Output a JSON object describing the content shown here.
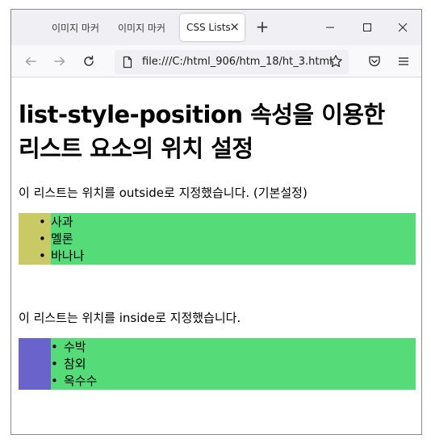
{
  "browser": {
    "tabs": [
      {
        "label": "이미지 마커",
        "active": false
      },
      {
        "label": "이미지 마커",
        "active": false
      },
      {
        "label": "CSS Lists",
        "active": true
      }
    ],
    "url": "file:///C:/html_906/htm_18/ht_3.html",
    "icons": {
      "back": "arrow-left-icon",
      "forward": "arrow-right-icon",
      "reload": "reload-icon",
      "file": "file-icon",
      "bookmark": "star-icon",
      "pocket": "pocket-icon",
      "menu": "hamburger-menu-icon",
      "new_tab": "plus-icon",
      "minimize": "minimize-icon",
      "maximize": "maximize-icon",
      "close": "close-icon"
    }
  },
  "page": {
    "title_line1": "list-style-position 속성을 이용한",
    "title_line2": "리스트 요소의 위치 설정",
    "outside_text": "이 리스트는 위치를 outside로 지정했습니다. (기본설정)",
    "outside_items": [
      "사과",
      "멜론",
      "바나나"
    ],
    "inside_text": "이 리스트는 위치를 inside로 지정했습니다.",
    "inside_items": [
      "수박",
      "참외",
      "옥수수"
    ],
    "bullet": "•"
  },
  "colors": {
    "outside_list_bg": "#c9c965",
    "inside_list_bg": "#6b63cc",
    "list_item_bg": "#55dc79"
  }
}
